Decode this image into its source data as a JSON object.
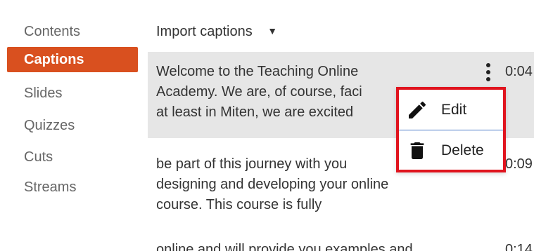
{
  "nav": {
    "items": [
      {
        "label": "Contents",
        "active": false
      },
      {
        "label": "Captions",
        "active": true
      },
      {
        "label": "Slides",
        "active": false
      },
      {
        "label": "Quizzes",
        "active": false
      },
      {
        "label": "Cuts",
        "active": false
      },
      {
        "label": "Streams",
        "active": false
      }
    ]
  },
  "import": {
    "label": "Import captions",
    "caret_icon": "caret-down-icon"
  },
  "captions": [
    {
      "lines": [
        "Welcome to the Teaching Online",
        "Academy. We are, of course, faci",
        "at least in Miten, we are excited"
      ],
      "time": "0:04"
    },
    {
      "lines": [
        "be part of this journey with you",
        "designing and developing your online",
        "course. This course is fully"
      ],
      "time": "0:09"
    },
    {
      "lines": [
        "online and will provide you examples and"
      ],
      "time": "0:14"
    }
  ],
  "menu": {
    "edit_label": "Edit",
    "edit_icon": "pencil-icon",
    "delete_label": "Delete",
    "delete_icon": "trash-icon"
  },
  "colors": {
    "active_nav": "#d9501f",
    "highlight_row": "#e6e6e6",
    "menu_border": "#e0141e",
    "menu_divider": "#4a78c8"
  }
}
